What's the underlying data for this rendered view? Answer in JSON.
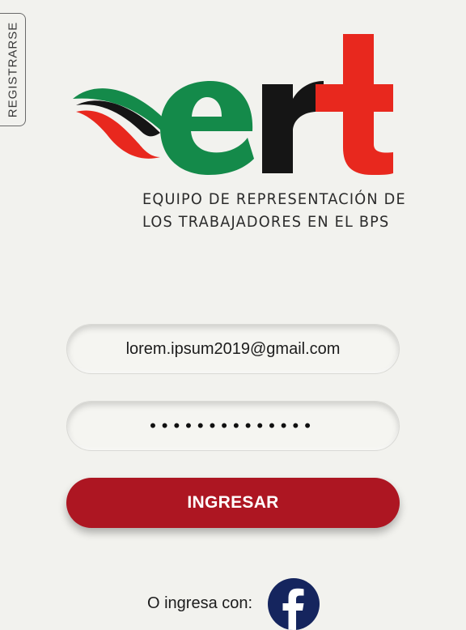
{
  "sidebar": {
    "register_label": "REGISTRARSE"
  },
  "logo": {
    "name": "ert",
    "colors": {
      "green": "#148a4a",
      "black": "#151515",
      "red": "#e8281e"
    }
  },
  "tagline": {
    "line1": "EQUIPO DE REPRESENTACIÓN DE",
    "line2": "LOS TRABAJADORES EN EL BPS"
  },
  "login": {
    "email_value": "lorem.ipsum2019@gmail.com",
    "password_masked": "••••••••••••••",
    "submit_label": "INGRESAR",
    "social_label": "O ingresa con:"
  },
  "colors": {
    "background": "#f2f2ee",
    "accent": "#ad1622",
    "facebook": "#15255e"
  },
  "icons": {
    "facebook": "facebook-icon"
  }
}
